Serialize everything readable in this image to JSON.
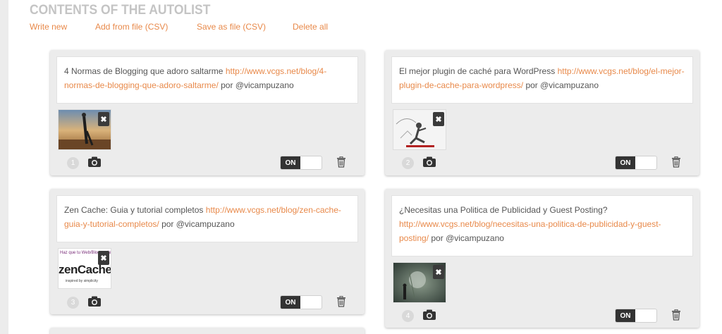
{
  "header": {
    "title": "CONTENTS OF THE AUTOLIST"
  },
  "actions": [
    {
      "label": "Write new"
    },
    {
      "label": "Add from file (CSV)"
    },
    {
      "label": "Save as file (CSV)"
    },
    {
      "label": "Delete all"
    }
  ],
  "cards": [
    {
      "title": "4 Normas de Blogging que adoro saltarme",
      "url": "http://www.vcgs.net/blog/4-normas-de-blogging-que-adoro-saltarme/",
      "author_prefix": "por",
      "author": "@vicampuzano",
      "number": "1",
      "toggle": "ON",
      "thumb_close": "✖"
    },
    {
      "title": "El mejor plugin de caché para WordPress",
      "url": "http://www.vcgs.net/blog/el-mejor-plugin-de-cache-para-wordpress/",
      "author_prefix": "por",
      "author": "@vicampuzano",
      "number": "2",
      "toggle": "ON",
      "thumb_close": "✖"
    },
    {
      "title": "Zen Cache: Guia y tutorial completos",
      "url": "http://www.vcgs.net/blog/zen-cache-guia-y-tutorial-completos/",
      "author_prefix": "por",
      "author": "@vicampuzano",
      "number": "3",
      "toggle": "ON",
      "thumb_close": "✖",
      "thumb_text_top": "Haz que tu Web/Blog vuele",
      "thumb_text_logo": "zenCache",
      "thumb_text_tag": "inspired by simplicity"
    },
    {
      "title": "¿Necesitas una Politica de Publicidad y Guest Posting?",
      "url": "http://www.vcgs.net/blog/necesitas-una-politica-de-publicidad-y-guest-posting/",
      "author_prefix": "por",
      "author": "@vicampuzano",
      "number": "4",
      "toggle": "ON",
      "thumb_close": "✖"
    }
  ]
}
